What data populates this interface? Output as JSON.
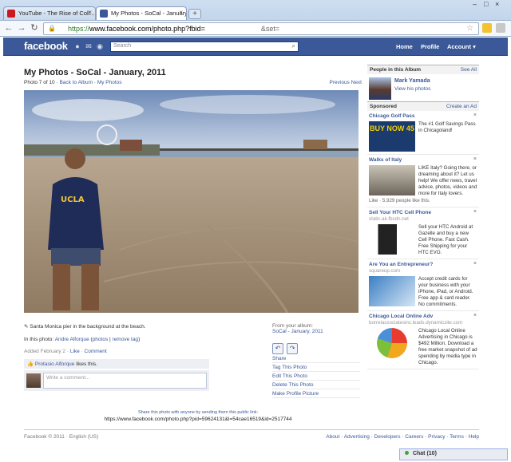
{
  "browser": {
    "tabs": [
      {
        "title": "YouTube - The Rise of Coll...",
        "favicon_color": "#cc181e"
      },
      {
        "title": "My Photos - SoCal - January...",
        "favicon_color": "#3b5998"
      }
    ],
    "new_tab": "+",
    "url_scheme": "https://",
    "url_host_path": "www.facebook.com/photo.php?fbid=",
    "url_param": "&set=",
    "window_controls": [
      "–",
      "□",
      "×"
    ]
  },
  "fb": {
    "logo": "facebook",
    "search_placeholder": "Search",
    "nav": {
      "home": "Home",
      "profile": "Profile",
      "account": "Account ▾"
    }
  },
  "album": {
    "title": "My Photos - SoCal - January, 2011",
    "photo_index": "Photo 7 of 10",
    "back_link": "Back to Album",
    "separator": "·",
    "my_photos_link": "My Photos",
    "prev": "Previous",
    "next": "Next"
  },
  "photo": {
    "caption": "Santa Monica pier in the background at the beach.",
    "in_photo_label": "In this photo:",
    "tagged_name": "Andre Alforque",
    "photos_link": "photos",
    "remove_tag_link": "remove tag",
    "added": "Added February 2",
    "like": "Like",
    "comment": "Comment",
    "likes_name": "Protasio Alforque",
    "likes_suffix": "likes this.",
    "comment_placeholder": "Write a comment...",
    "from_album_label": "From your album:",
    "album_link": "SoCal - January, 2011",
    "actions": [
      "Share",
      "Tag This Photo",
      "Edit This Photo",
      "Delete This Photo",
      "Make Profile Picture"
    ],
    "share_hint": "Share this photo with anyone by sending them this public link:",
    "share_url": "https://www.facebook.com/photo.php?pid=59624131&l=54cae16519&id=2517744"
  },
  "sidebar": {
    "people_heading": "People in this Album",
    "see_all": "See All",
    "person_name": "Mark Yamada",
    "person_link": "View his photos",
    "sponsored": "Sponsored",
    "create_ad": "Create an Ad",
    "ads": [
      {
        "title": "Chicago Golf Pass",
        "domain": "",
        "text": "The #1 Golf Savings Pass in Chicagoland!",
        "likes": "",
        "img": "BUY NOW 45"
      },
      {
        "title": "Walks of Italy",
        "domain": "",
        "text": "LIKE Italy? Going there, or dreaming about it? Let us help! We offer news, travel advice, photos, videos and more for Italy lovers.",
        "likes": "Like · 5,929 people like this.",
        "img": ""
      },
      {
        "title": "Sell Your HTC Cell Phone",
        "domain": "static.ak.fbcdn.net",
        "text": "Sell your HTC Android at Gazelle and buy a new Cell Phone. Fast Cash. Free Shipping for your HTC EVO.",
        "likes": "",
        "img": ""
      },
      {
        "title": "Are You an Entrepreneur?",
        "domain": "squareup.com",
        "text": "Accept credit cards for your business with your iPhone, iPad, or Android. Free app & card reader. No commitments.",
        "likes": "",
        "img": ""
      },
      {
        "title": "Chicago Local Online Adv",
        "domain": "borrelassociatesinc.leads.dynamicsite.com",
        "text": "Chicago Local Online Advertising in Chicago is $492 Million. Download a free market snapshot of ad spending by media type in Chicago.",
        "likes": "",
        "img": ""
      }
    ],
    "close": "×"
  },
  "footer": {
    "copyright": "Facebook © 2011 · English (US)",
    "links": "About · Advertising · Developers · Careers · Privacy · Terms · Help"
  },
  "chat": {
    "label": "Chat (10)"
  }
}
